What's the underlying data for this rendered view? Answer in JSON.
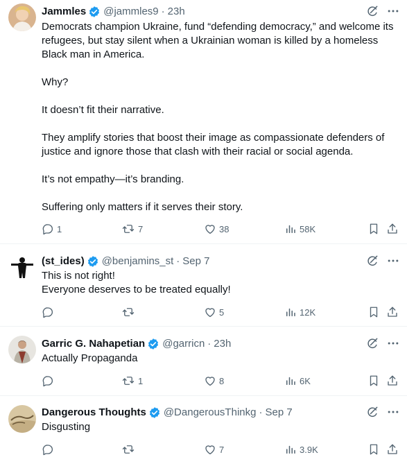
{
  "tweets": [
    {
      "name": "Jammles",
      "handle": "@jammles9",
      "time": "23h",
      "paragraphs": [
        "Democrats champion Ukraine, fund “defending democracy,” and welcome its refugees, but stay silent when a Ukrainian woman is killed by a homeless Black man in America.",
        "Why?",
        "It doesn’t fit their narrative.",
        "They amplify stories that boost their image as compassionate defenders of justice and ignore those that clash with their racial or social agenda.",
        "It’s not empathy—it’s branding.",
        "Suffering only matters if it serves their story."
      ],
      "replies": "1",
      "reposts": "7",
      "likes": "38",
      "views": "58K"
    },
    {
      "name": "(st_ides)",
      "handle": "@benjamins_st",
      "time": "Sep 7",
      "paragraphs": [
        "This is not right!",
        "Everyone deserves to be treated equally!"
      ],
      "replies": "",
      "reposts": "",
      "likes": "5",
      "views": "12K"
    },
    {
      "name": "Garric G. Nahapetian",
      "handle": "@garricn",
      "time": "23h",
      "paragraphs": [
        "Actually Propaganda"
      ],
      "replies": "",
      "reposts": "1",
      "likes": "8",
      "views": "6K"
    },
    {
      "name": "Dangerous Thoughts",
      "handle": "@DangerousThinkg",
      "time": "Sep 7",
      "paragraphs": [
        "Disgusting"
      ],
      "replies": "",
      "reposts": "",
      "likes": "7",
      "views": "3.9K"
    }
  ],
  "separator": "·",
  "colors": {
    "verified": "#1d9bf0",
    "meta": "#536471",
    "text": "#0f1419",
    "divider": "#eff3f4"
  },
  "icons": [
    "verified-badge-icon",
    "grok-icon",
    "more-icon",
    "reply-icon",
    "repost-icon",
    "like-icon",
    "views-icon",
    "bookmark-icon",
    "share-icon"
  ]
}
